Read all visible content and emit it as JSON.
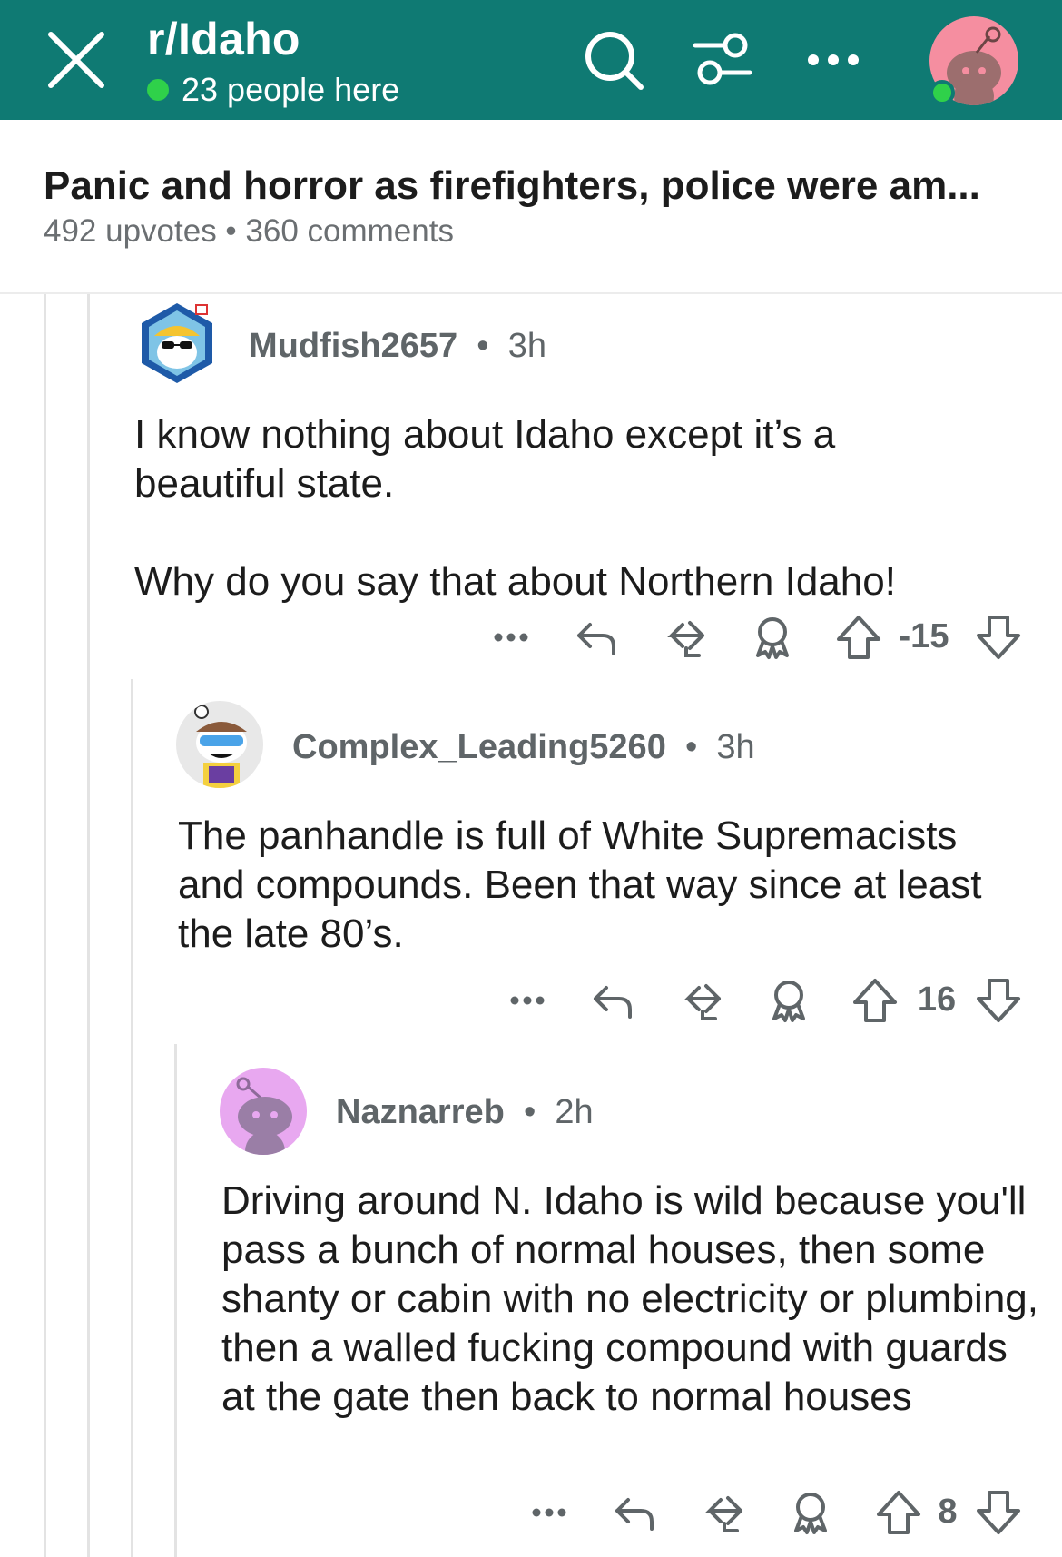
{
  "header": {
    "subreddit": "r/Idaho",
    "online_text": "23 people here"
  },
  "post": {
    "title": "Panic and horror as firefighters, police were am...",
    "meta": "492 upvotes • 360 comments"
  },
  "comments": [
    {
      "username": "Mudfish2657",
      "age": "3h",
      "paragraphs": [
        "I know nothing about Idaho except it’s a beautiful state.",
        "Why do you say that about Northern Idaho!"
      ],
      "score": "-15"
    },
    {
      "username": "Complex_Leading5260",
      "age": "3h",
      "paragraphs": [
        "The panhandle is full of White Supremacists and compounds. Been that way since at least the late 80’s."
      ],
      "score": "16"
    },
    {
      "username": "Naznarreb",
      "age": "2h",
      "paragraphs": [
        "Driving around N. Idaho is wild because you'll pass a bunch of normal houses, then some shanty or cabin with no electricity or plumbing, then a walled fucking compound with guards at the gate then back to normal houses"
      ],
      "score": "8"
    }
  ],
  "icons": {
    "close": "close-icon",
    "search": "search-icon",
    "filter": "filter-icon",
    "more": "more-icon",
    "reply": "reply-icon",
    "share": "share-icon",
    "award": "award-icon",
    "upvote": "upvote-icon",
    "downvote": "downvote-icon"
  },
  "colors": {
    "header_bg": "#0f7a73",
    "online": "#2fd14a",
    "meta_text": "#6b6f72"
  }
}
